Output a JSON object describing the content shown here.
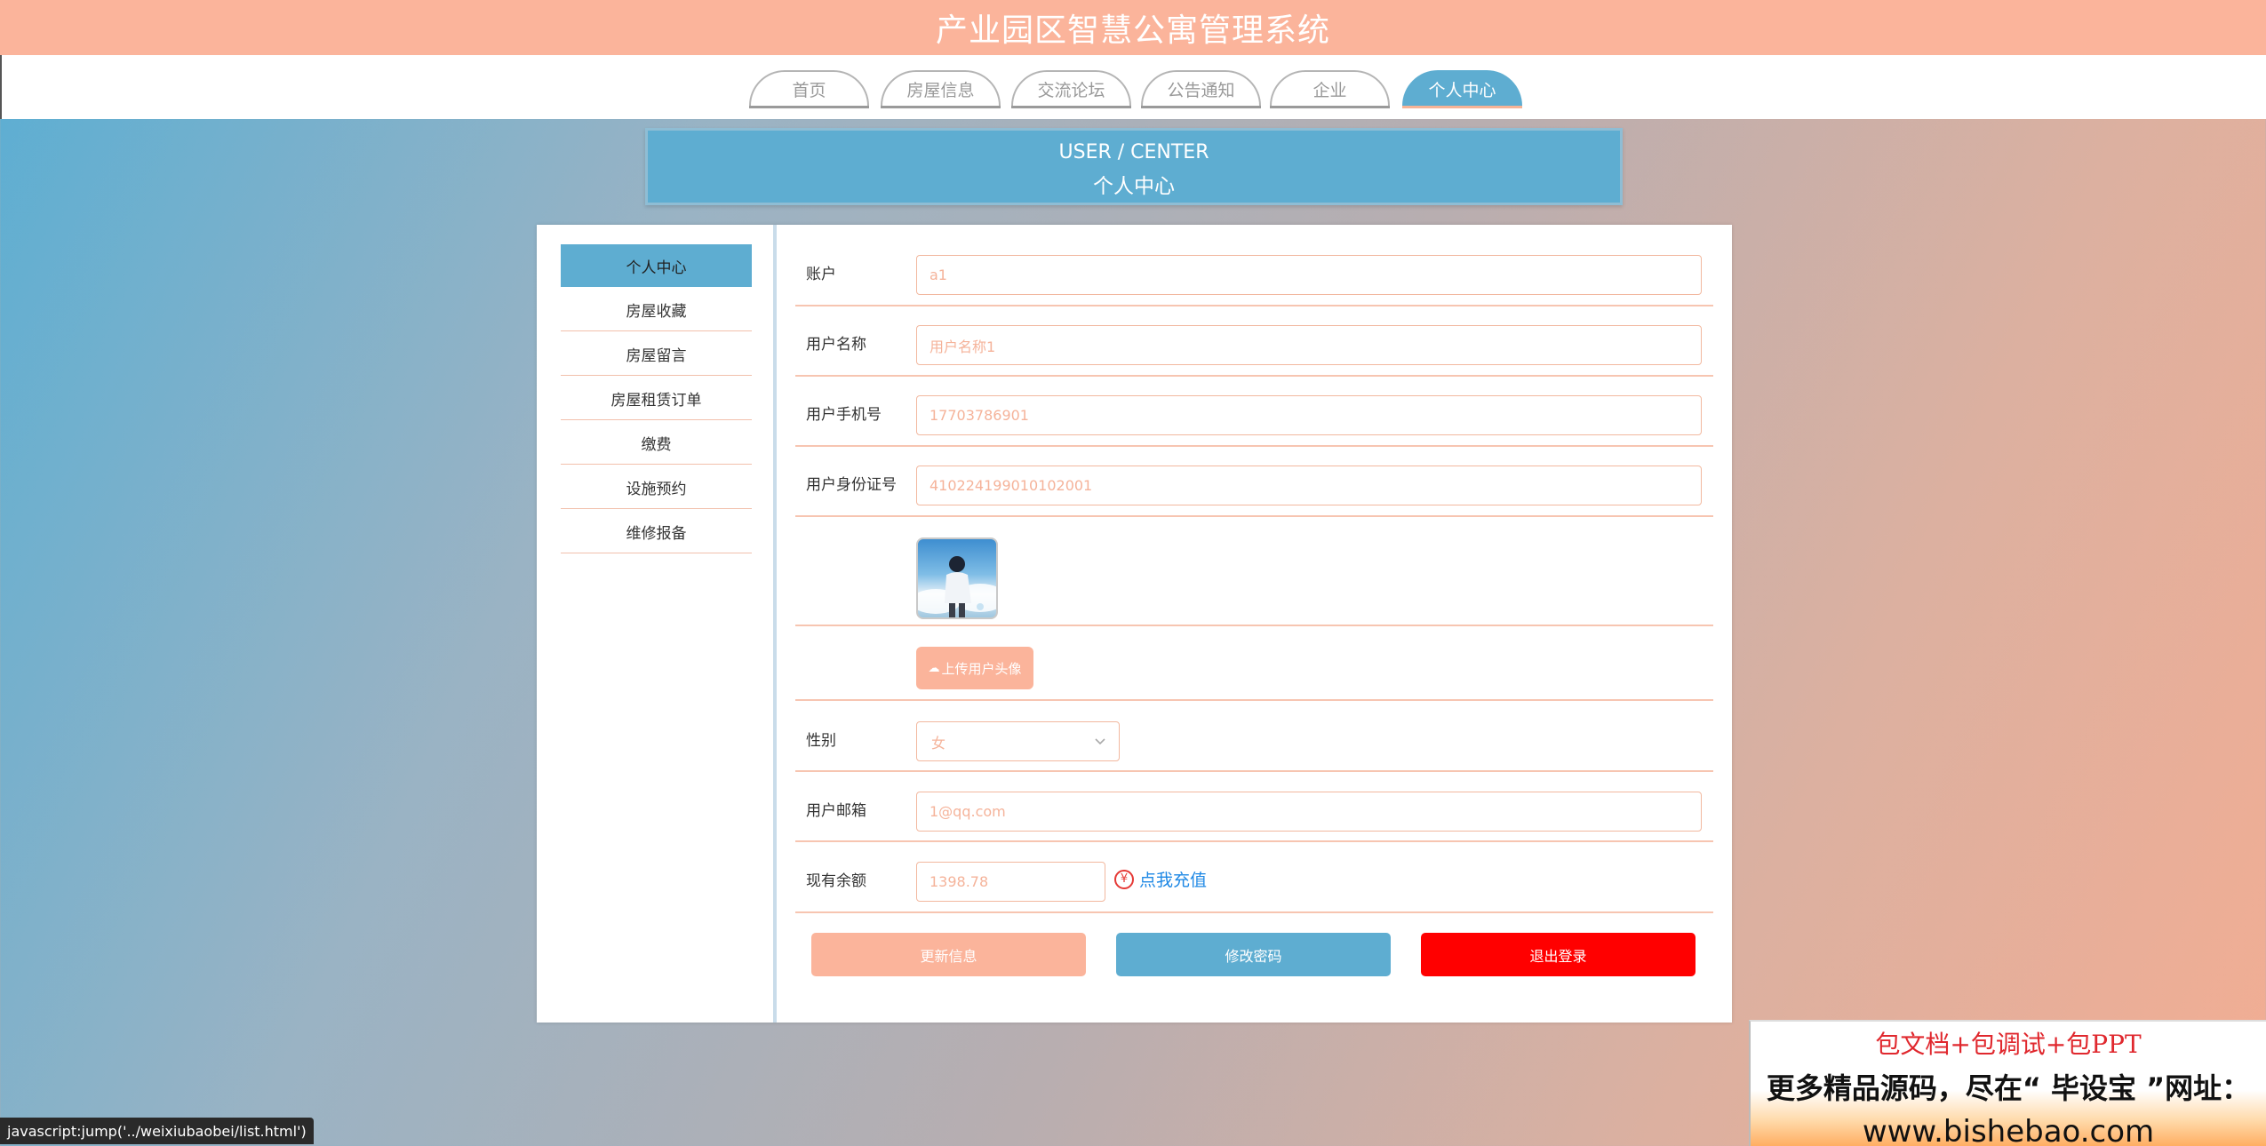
{
  "header": {
    "title": "产业园区智慧公寓管理系统"
  },
  "nav": {
    "tabs": [
      {
        "label": "首页"
      },
      {
        "label": "房屋信息"
      },
      {
        "label": "交流论坛"
      },
      {
        "label": "公告通知"
      },
      {
        "label": "企业"
      },
      {
        "label": "个人中心"
      }
    ],
    "active": "个人中心"
  },
  "banner": {
    "en": "USER / CENTER",
    "cn": "个人中心"
  },
  "sidebar": {
    "items": [
      {
        "label": "个人中心"
      },
      {
        "label": "房屋收藏"
      },
      {
        "label": "房屋留言"
      },
      {
        "label": "房屋租赁订单"
      },
      {
        "label": "缴费"
      },
      {
        "label": "设施预约"
      },
      {
        "label": "维修报备"
      }
    ]
  },
  "form": {
    "account": {
      "label": "账户",
      "value": "a1"
    },
    "username": {
      "label": "用户名称",
      "value": "用户名称1"
    },
    "phone": {
      "label": "用户手机号",
      "value": "17703786901"
    },
    "idcard": {
      "label": "用户身份证号",
      "value": "410224199010102001"
    },
    "upload_label": "上传用户头像",
    "gender": {
      "label": "性别",
      "value": "女"
    },
    "email": {
      "label": "用户邮箱",
      "value": "1@qq.com"
    },
    "balance": {
      "label": "现有余额",
      "value": "1398.78",
      "recharge": "点我充值"
    }
  },
  "actions": {
    "update": "更新信息",
    "change_password": "修改密码",
    "logout": "退出登录"
  },
  "status_url": "javascript:jump('../weixiubaobei/list.html')",
  "ad": {
    "line1": "包文档+包调试+包PPT",
    "line2": "更多精品源码，尽在“ 毕设宝 ”网址：",
    "line3": "www.bishebao.com"
  },
  "colors": {
    "accent_blue": "#5eadd1",
    "accent_peach": "#fbb49b",
    "danger": "#ff0000"
  }
}
